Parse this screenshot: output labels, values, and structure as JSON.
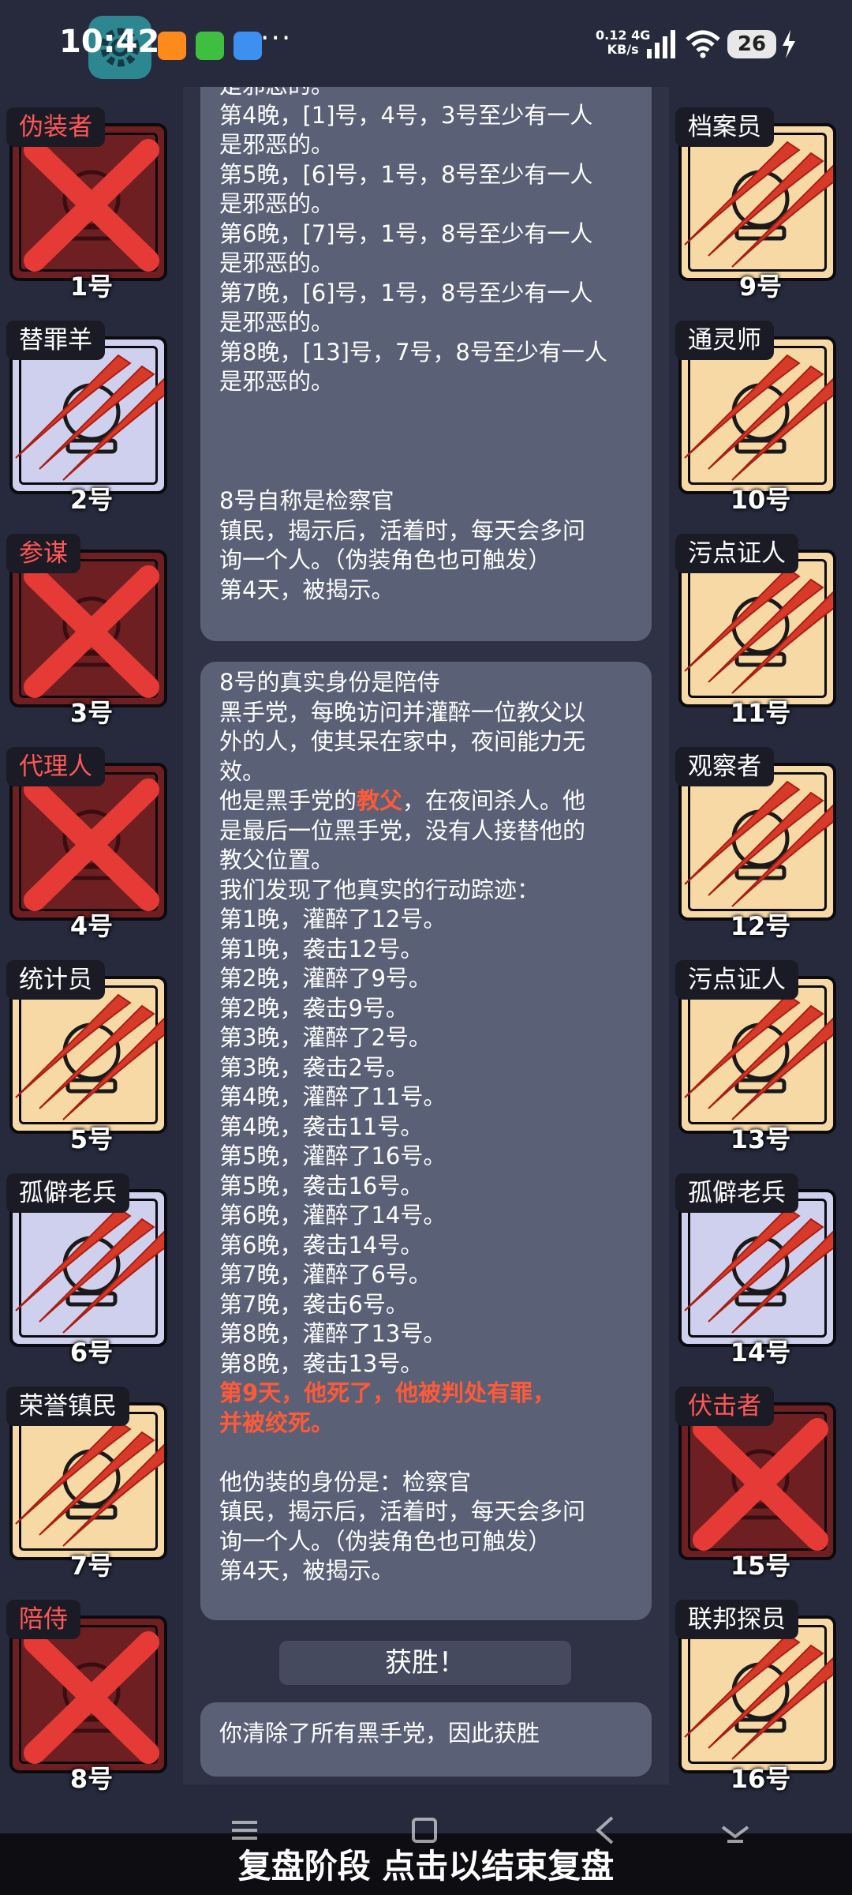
{
  "status_bar": {
    "time": "10:42",
    "net_speed": "0.12",
    "net_unit": "KB/s",
    "net_type": "4G",
    "battery": "26"
  },
  "capsule": {
    "more": "•••"
  },
  "players_left": [
    {
      "role": "伪装者",
      "num": "1号",
      "evil": true
    },
    {
      "role": "替罪羊",
      "num": "2号",
      "evil": false
    },
    {
      "role": "参谋",
      "num": "3号",
      "evil": true
    },
    {
      "role": "代理人",
      "num": "4号",
      "evil": true
    },
    {
      "role": "统计员",
      "num": "5号",
      "evil": false
    },
    {
      "role": "孤僻老兵",
      "num": "6号",
      "evil": false
    },
    {
      "role": "荣誉镇民",
      "num": "7号",
      "evil": false
    },
    {
      "role": "陪侍",
      "num": "8号",
      "evil": true
    }
  ],
  "players_right": [
    {
      "role": "档案员",
      "num": "9号",
      "evil": false
    },
    {
      "role": "通灵师",
      "num": "10号",
      "evil": false
    },
    {
      "role": "污点证人",
      "num": "11号",
      "evil": false
    },
    {
      "role": "观察者",
      "num": "12号",
      "evil": false
    },
    {
      "role": "污点证人",
      "num": "13号",
      "evil": false
    },
    {
      "role": "孤僻老兵",
      "num": "14号",
      "evil": false
    },
    {
      "role": "伏击者",
      "num": "15号",
      "evil": true
    },
    {
      "role": "联邦探员",
      "num": "16号",
      "evil": false
    }
  ],
  "log": {
    "bubble1": [
      "是邪恶的。",
      "第4晚，[1]号，4号，3号至少有一人",
      "是邪恶的。",
      "第5晚，[6]号，1号，8号至少有一人",
      "是邪恶的。",
      "第6晚，[7]号，1号，8号至少有一人",
      "是邪恶的。",
      "第7晚，[6]号，1号，8号至少有一人",
      "是邪恶的。",
      "第8晚，[13]号，7号，8号至少有一人",
      "是邪恶的。"
    ],
    "bubble2": [
      "8号自称是检察官",
      "镇民，揭示后，活着时，每天会多问",
      "询一个人。（伪装角色也可触发）",
      "第4天，被揭示。"
    ],
    "bubble3": {
      "lines_a": [
        "8号的真实身份是陪侍",
        "黑手党，每晚访问并灌醉一位教父以",
        "外的人，使其呆在家中，夜间能力无",
        "效。"
      ],
      "godfather_pre": "他是黑手党的",
      "godfather_word": "教父",
      "godfather_post": "，在夜间杀人。他",
      "lines_b": [
        "是最后一位黑手党，没有人接替他的",
        "教父位置。",
        "我们发现了他真实的行动踪迹：",
        "第1晚，灌醉了12号。",
        "第1晚，袭击12号。",
        "第2晚，灌醉了9号。",
        "第2晚，袭击9号。",
        "第3晚，灌醉了2号。",
        "第3晚，袭击2号。",
        "第4晚，灌醉了11号。",
        "第4晚，袭击11号。",
        "第5晚，灌醉了16号。",
        "第5晚，袭击16号。",
        "第6晚，灌醉了14号。",
        "第6晚，袭击14号。",
        "第7晚，灌醉了6号。",
        "第7晚，袭击6号。",
        "第8晚，灌醉了13号。",
        "第8晚，袭击13号。"
      ],
      "death_lines": [
        "第9天，他死了，他被判处有罪，",
        "并被绞死。"
      ],
      "lines_c": [
        "",
        "他伪装的身份是：检察官",
        "镇民，揭示后，活着时，每天会多问",
        "询一个人。（伪装角色也可触发）",
        "第4天，被揭示。"
      ]
    },
    "victory": "获胜！",
    "bubble4": "你清除了所有黑手党，因此获胜"
  },
  "bottom_bar": {
    "text": "复盘阶段 点击以结束复盘"
  },
  "colors": {
    "background": "#262a3c",
    "panel": "#2e3244",
    "bubble": "#5a6177",
    "evil_role": "#ff5757",
    "highlight": "#ff5a37",
    "good_card": "#f7d9a6",
    "blue_card": "#cfd0ee",
    "evil_card": "#6e1f22"
  }
}
